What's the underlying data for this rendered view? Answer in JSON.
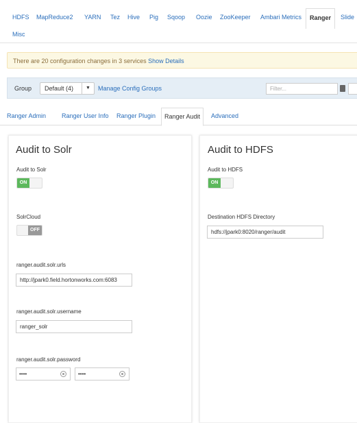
{
  "service_tabs": [
    {
      "label": "HDFS"
    },
    {
      "label": "MapReduce2"
    },
    {
      "label": "YARN"
    },
    {
      "label": "Tez"
    },
    {
      "label": "Hive"
    },
    {
      "label": "Pig"
    },
    {
      "label": "Sqoop"
    },
    {
      "label": "Oozie"
    },
    {
      "label": "ZooKeeper"
    },
    {
      "label": "Ambari Metrics"
    },
    {
      "label": "Ranger",
      "active": true
    },
    {
      "label": "Slide"
    },
    {
      "label": "Misc"
    }
  ],
  "alert": {
    "text": "There are 20 configuration changes in 3 services ",
    "link": "Show Details"
  },
  "group_bar": {
    "group_label": "Group",
    "selected_group": "Default (4)",
    "manage_link": "Manage Config Groups",
    "filter_placeholder": "Filter..."
  },
  "sub_tabs": [
    {
      "label": "Ranger Admin"
    },
    {
      "label": "Ranger User Info"
    },
    {
      "label": "Ranger Plugin"
    },
    {
      "label": "Ranger Audit",
      "active": true
    },
    {
      "label": "Advanced"
    }
  ],
  "solr_panel": {
    "title": "Audit to Solr",
    "audit_to_solr_label": "Audit to Solr",
    "audit_to_solr_state": "ON",
    "solrcloud_label": "SolrCloud",
    "solrcloud_state": "OFF",
    "urls_label": "ranger.audit.solr.urls",
    "urls_value": "http://jpark0.field.hortonworks.com:6083",
    "username_label": "ranger.audit.solr.username",
    "username_value": "ranger_solr",
    "password_label": "ranger.audit.solr.password",
    "password_mask": "••••",
    "password_confirm_mask": "••••"
  },
  "hdfs_panel": {
    "title": "Audit to HDFS",
    "audit_to_hdfs_label": "Audit to HDFS",
    "audit_to_hdfs_state": "ON",
    "dest_dir_label": "Destination HDFS Directory",
    "dest_dir_value": "hdfs://jpark0:8020/ranger/audit"
  },
  "colors": {
    "link": "#2a6ebb",
    "toggle_on": "#5cb85c",
    "toggle_off": "#999999",
    "alert_bg": "#fcf8e3",
    "group_bar_bg": "#e5eef6"
  }
}
